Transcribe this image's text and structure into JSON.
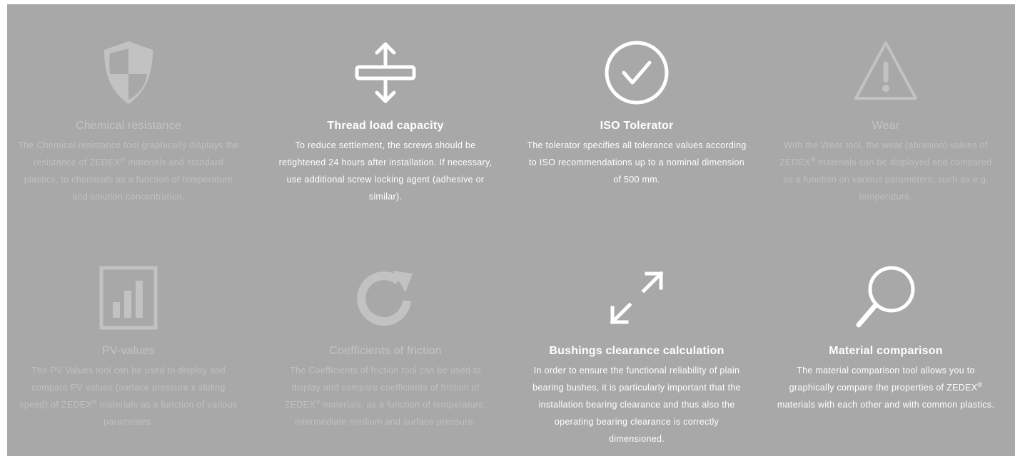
{
  "colors": {
    "panel_bg": "#a8a8a8",
    "active_text": "#ffffff",
    "dim_text": "#c4c4c4",
    "dim_icon": "#c2c2c2"
  },
  "tools": [
    {
      "icon": "shield-icon",
      "title": "Chemical resistance",
      "desc_pre": "The Chemical resistance tool graphically displays the resistance of ZEDEX",
      "desc_sup": "®",
      "desc_post": " materials and standard plastics, to chemicals as a function of temperature and solution concentration.",
      "active": false
    },
    {
      "icon": "vertical-arrows-icon",
      "title": "Thread load capacity",
      "desc_pre": "To reduce settlement, the screws should be retightened 24 hours after installation. If necessary, use additional screw locking agent (adhesive or similar).",
      "desc_sup": "",
      "desc_post": "",
      "active": true
    },
    {
      "icon": "checkmark-circle-icon",
      "title": "ISO Tolerator",
      "desc_pre": "The tolerator specifies all tolerance values according to ISO recommendations up to a nominal dimension of 500 mm.",
      "desc_sup": "",
      "desc_post": "",
      "active": true
    },
    {
      "icon": "warning-icon",
      "title": "Wear",
      "desc_pre": "With the Wear tool, the wear (abrasion) values of ZEDEX",
      "desc_sup": "®",
      "desc_post": " materials can be displayed and compared as a function on various parameters, such as e.g. temperature.",
      "active": false
    },
    {
      "icon": "bar-chart-icon",
      "title": "PV-values",
      "desc_pre": "The PV Values tool can be used to display and compare PV values (surface pressure x sliding speed) of ZEDEX",
      "desc_sup": "®",
      "desc_post": " materials as a function of various parameters.",
      "active": false
    },
    {
      "icon": "refresh-icon",
      "title": "Coefficients of friction",
      "desc_pre": "The Coefficients of friction tool can be used to display and compare coefficients of friction of ZEDEX",
      "desc_sup": "®",
      "desc_post": " materials, as a function of temperature, intermediate medium and surface pressure.",
      "active": false
    },
    {
      "icon": "expand-arrows-icon",
      "title": "Bushings clearance calculation",
      "desc_pre": "In order to ensure the functional reliability of plain bearing bushes, it is particularly important that the installation bearing clearance and thus also the operating bearing clearance is correctly dimensioned.",
      "desc_sup": "",
      "desc_post": "",
      "active": true
    },
    {
      "icon": "magnifier-icon",
      "title": "Material comparison",
      "desc_pre": "The material comparison tool allows you to graphically compare the properties of ZEDEX",
      "desc_sup": "®",
      "desc_post": " materials with each other and with common plastics.",
      "active": true
    }
  ]
}
